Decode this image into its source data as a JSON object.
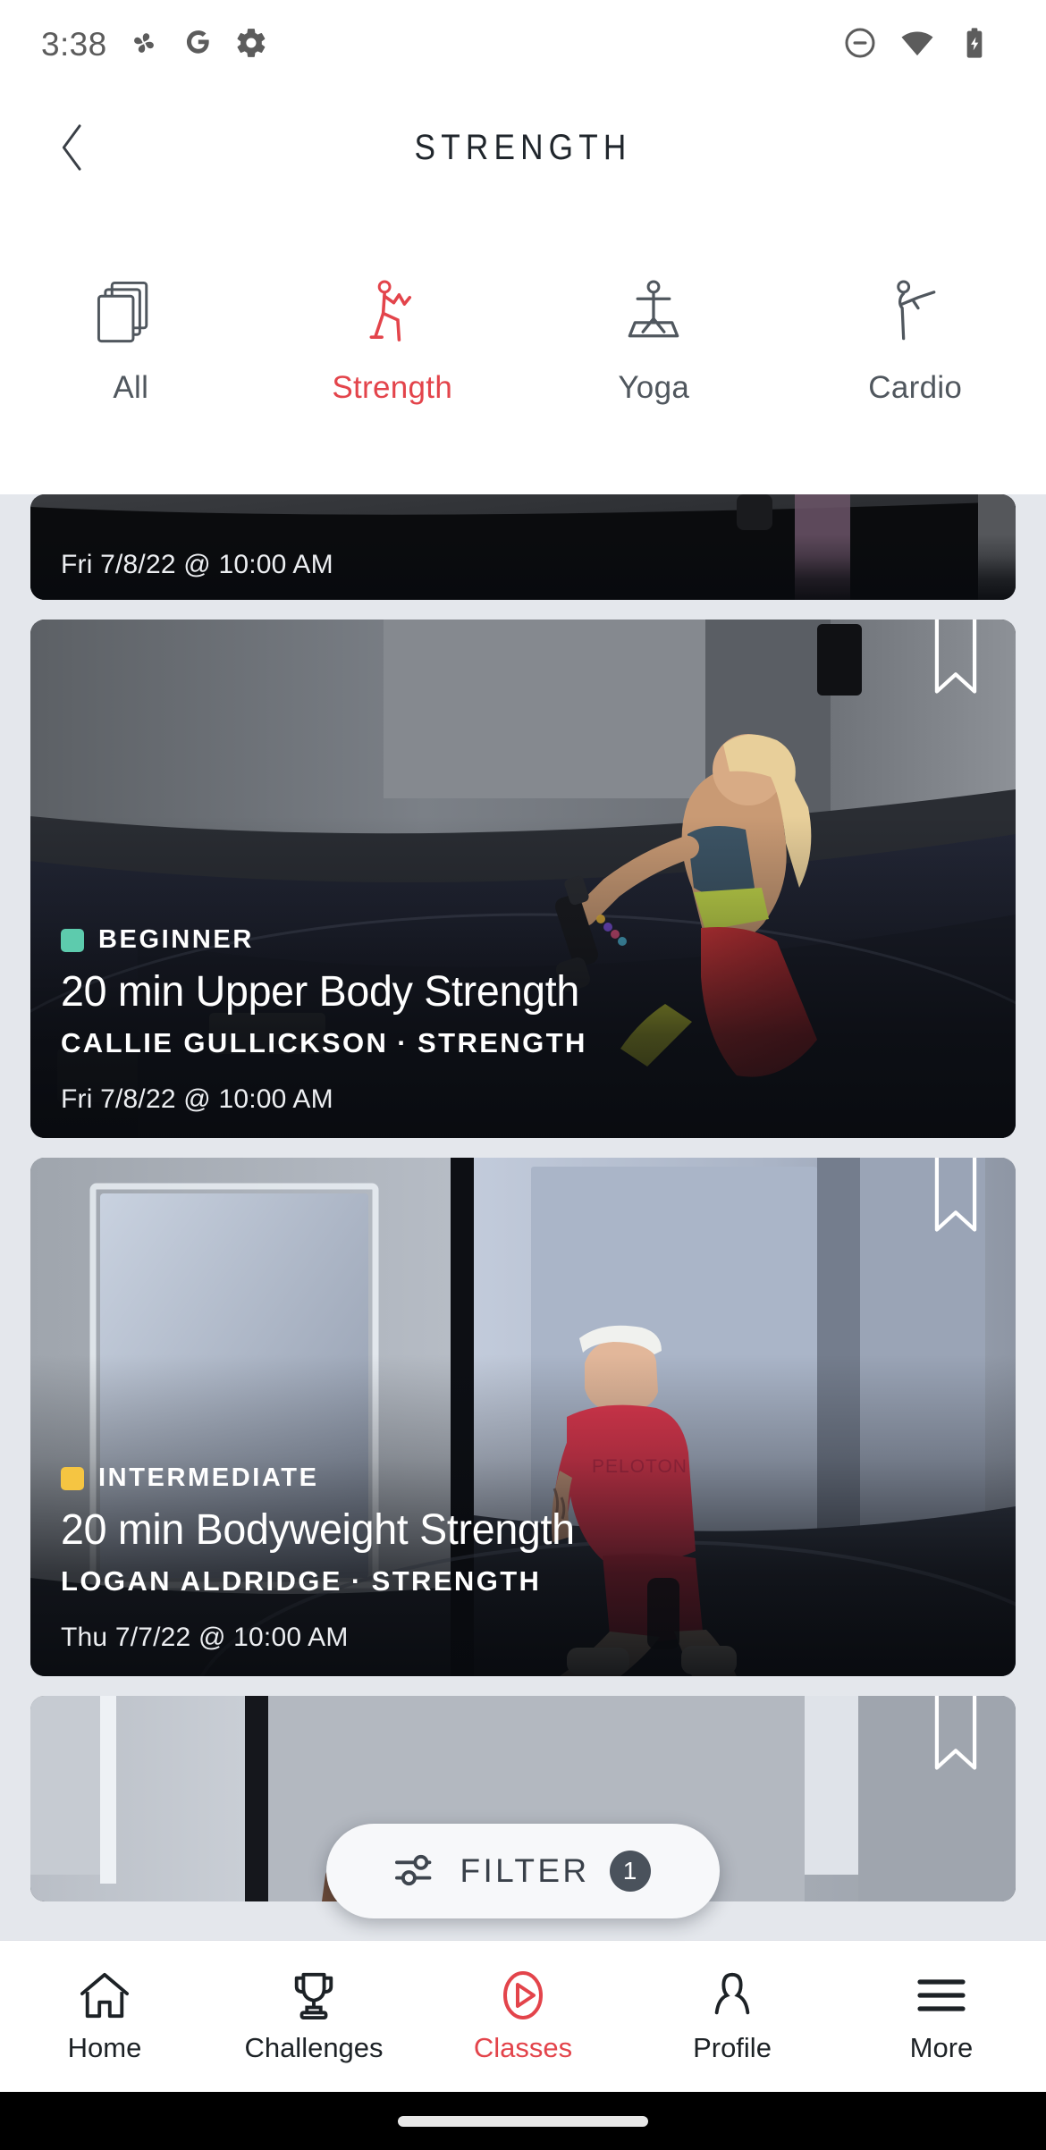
{
  "status_bar": {
    "time": "3:38",
    "left_icons": [
      "pinwheel-icon",
      "google-g-icon",
      "gear-icon"
    ],
    "right_icons": [
      "do-not-disturb-icon",
      "wifi-icon",
      "battery-charging-icon"
    ]
  },
  "header": {
    "title": "STRENGTH",
    "back_icon": "chevron-left-icon"
  },
  "category_tabs": {
    "active_index": 1,
    "items": [
      {
        "label": "All",
        "icon": "stacked-cards-icon"
      },
      {
        "label": "Strength",
        "icon": "strength-figure-icon"
      },
      {
        "label": "Yoga",
        "icon": "yoga-figure-icon"
      },
      {
        "label": "Cardio",
        "icon": "cardio-figure-icon"
      }
    ]
  },
  "classes": [
    {
      "difficulty": "",
      "difficulty_color": "",
      "title": "",
      "instructor": "",
      "discipline": "",
      "date": "Fri 7/8/22 @ 10:00 AM",
      "bookmark_icon": "bookmark-icon"
    },
    {
      "difficulty": "BEGINNER",
      "difficulty_color": "#5dcbad",
      "title": "20 min Upper Body Strength",
      "instructor": "CALLIE GULLICKSON",
      "discipline": "STRENGTH",
      "separator": "·",
      "date": "Fri 7/8/22 @ 10:00 AM",
      "bookmark_icon": "bookmark-icon"
    },
    {
      "difficulty": "INTERMEDIATE",
      "difficulty_color": "#f5c542",
      "title": "20 min Bodyweight Strength",
      "instructor": "LOGAN ALDRIDGE",
      "discipline": "STRENGTH",
      "separator": "·",
      "date": "Thu 7/7/22 @ 10:00 AM",
      "bookmark_icon": "bookmark-icon"
    },
    {
      "difficulty": "",
      "difficulty_color": "",
      "title": "",
      "instructor": "",
      "discipline": "",
      "date": "",
      "bookmark_icon": "bookmark-icon"
    }
  ],
  "filter": {
    "label": "FILTER",
    "count": "1",
    "icon": "sliders-icon"
  },
  "bottom_nav": {
    "active_index": 2,
    "items": [
      {
        "label": "Home",
        "icon": "home-icon"
      },
      {
        "label": "Challenges",
        "icon": "trophy-icon"
      },
      {
        "label": "Classes",
        "icon": "play-circle-icon"
      },
      {
        "label": "Profile",
        "icon": "person-icon"
      },
      {
        "label": "More",
        "icon": "hamburger-icon"
      }
    ]
  },
  "colors": {
    "accent_red": "#e3444b",
    "background": "#e4e7ec",
    "surface": "#ffffff",
    "text_dark": "#20262c",
    "text_muted": "#50575e"
  }
}
